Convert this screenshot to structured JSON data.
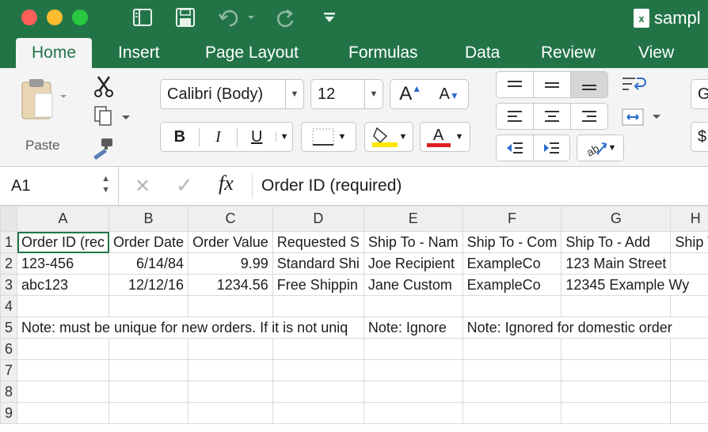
{
  "window": {
    "file_title": "sampl",
    "file_icon": "x"
  },
  "ribbon_tabs": [
    "Home",
    "Insert",
    "Page Layout",
    "Formulas",
    "Data",
    "Review",
    "View"
  ],
  "clipboard": {
    "paste_label": "Paste"
  },
  "font": {
    "family": "Calibri (Body)",
    "size": "12",
    "bold": "B",
    "italic": "I",
    "underline": "U",
    "grow": "A",
    "shrink": "A",
    "color_glyph": "A"
  },
  "formula_bar": {
    "cell_ref": "A1",
    "fx": "fx",
    "content": "Order ID (required)"
  },
  "columns": [
    "A",
    "B",
    "C",
    "D",
    "E",
    "F",
    "G",
    "H"
  ],
  "rows": [
    {
      "n": "1",
      "cells": [
        "Order ID (rec",
        "Order Date",
        "Order Value",
        "Requested S",
        "Ship To - Nam",
        "Ship To - Com",
        "Ship To - Add",
        "Ship T"
      ]
    },
    {
      "n": "2",
      "cells": [
        "123-456",
        "6/14/84",
        "9.99",
        "Standard Shi",
        "Joe Recipient",
        "ExampleCo",
        "123 Main Street",
        ""
      ]
    },
    {
      "n": "3",
      "cells": [
        "abc123",
        "12/12/16",
        "1234.56",
        "Free Shippin",
        "Jane Custom",
        "ExampleCo",
        "12345 Example Wy",
        ""
      ]
    },
    {
      "n": "4",
      "cells": [
        "",
        "",
        "",
        "",
        "",
        "",
        "",
        ""
      ]
    },
    {
      "n": "5",
      "cells": [
        "Note: must be unique for new orders. If it is not uniq",
        "",
        "",
        "",
        "Note: Ignore",
        "Note: Ignored for domestic order",
        "",
        ""
      ]
    },
    {
      "n": "6",
      "cells": [
        "",
        "",
        "",
        "",
        "",
        "",
        "",
        ""
      ]
    },
    {
      "n": "7",
      "cells": [
        "",
        "",
        "",
        "",
        "",
        "",
        "",
        ""
      ]
    },
    {
      "n": "8",
      "cells": [
        "",
        "",
        "",
        "",
        "",
        "",
        "",
        ""
      ]
    },
    {
      "n": "9",
      "cells": [
        "",
        "",
        "",
        "",
        "",
        "",
        "",
        ""
      ]
    }
  ],
  "colors": {
    "excel_green": "#227447",
    "selection": "#227447",
    "highlight_yellow": "#ffe600",
    "font_red": "#e02020"
  }
}
